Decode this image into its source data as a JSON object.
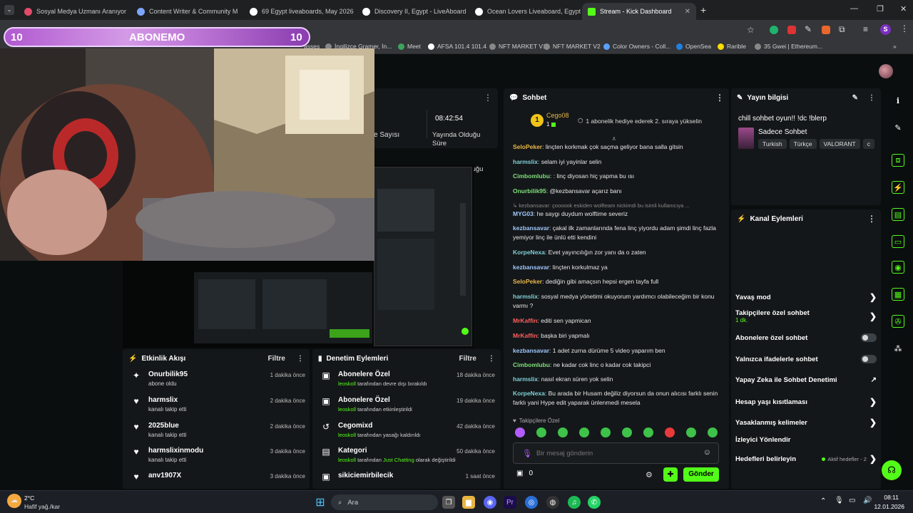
{
  "browser": {
    "tabs": [
      {
        "title": "Sosyal Medya Uzmanı Aranıyor",
        "color": "#e24a6b"
      },
      {
        "title": "Content Writer & Community M",
        "color": "#7da6ff"
      },
      {
        "title": "69 Egypt liveaboards, May 2026",
        "color": "#ffffff"
      },
      {
        "title": "Discovery II, Egypt - LiveAboard",
        "color": "#ffffff"
      },
      {
        "title": "Ocean Lovers Liveaboard, Egypt",
        "color": "#ffffff"
      },
      {
        "title": "Stream - Kick Dashboard",
        "color": "#53fc18"
      }
    ],
    "bookmarks": [
      {
        "label": "asses"
      },
      {
        "label": "İngilizce Gramer, İn..."
      },
      {
        "label": "Meet"
      },
      {
        "label": "AFSA 101.4 101.4"
      },
      {
        "label": "NFT MARKET V1"
      },
      {
        "label": "NFT MARKET V2"
      },
      {
        "label": "Color Owners - Coll..."
      },
      {
        "label": "OpenSea"
      },
      {
        "label": "Rarible"
      },
      {
        "label": "35 Gwei | Ethereum..."
      }
    ],
    "profile_letter": "S"
  },
  "overlay": {
    "left_count": "10",
    "title": "ABONEMO",
    "right_count": "10"
  },
  "stats": {
    "viewers_label": "e Sayısı",
    "uptime_value": "08:42:54",
    "uptime_label": "Yayında Olduğu Süre"
  },
  "activity": {
    "title": "Etkinlik Akışı",
    "filter": "Filtre",
    "items": [
      {
        "icon": "sparkle-icon",
        "glyph": "✦",
        "name": "Onurbilik95",
        "sub": "abone oldu",
        "time": "1 dakika önce"
      },
      {
        "icon": "heart-icon",
        "glyph": "♥",
        "name": "harmslix",
        "sub": "kanalı takip etti",
        "time": "2 dakika önce"
      },
      {
        "icon": "heart-icon",
        "glyph": "♥",
        "name": "2025blue",
        "sub": "kanalı takip etti",
        "time": "2 dakika önce"
      },
      {
        "icon": "heart-icon",
        "glyph": "♥",
        "name": "harmslixinmodu",
        "sub": "kanalı takip etti",
        "time": "3 dakika önce"
      },
      {
        "icon": "heart-icon",
        "glyph": "♥",
        "name": "anv1907X",
        "sub": "",
        "time": "3 dakika önce"
      }
    ]
  },
  "moderation": {
    "title": "Denetim Eylemleri",
    "filter": "Filtre",
    "items": [
      {
        "icon": "gift-icon",
        "glyph": "▣",
        "name": "Abonelere Özel",
        "user": "leoskoll",
        "sub": " tarafından devre dışı bırakıldı",
        "time": "18 dakika önce"
      },
      {
        "icon": "gift-icon",
        "glyph": "▣",
        "name": "Abonelere Özel",
        "user": "leoskoll",
        "sub": " tarafından etkinleştirildi",
        "time": "19 dakika önce"
      },
      {
        "icon": "undo-icon",
        "glyph": "↺",
        "name": "Cegomixd",
        "user": "leoskoll",
        "sub": " tarafından yasağı kaldırıldı",
        "time": "42 dakika önce"
      },
      {
        "icon": "category-icon",
        "glyph": "▤",
        "name": "Kategori",
        "user": "leoskoll",
        "sub": " tarafından ",
        "hl": "Just Chatting",
        "sub2": " olarak değiştirildi",
        "time": "50 dakika önce"
      },
      {
        "icon": "gift-icon",
        "glyph": "▣",
        "name": "sikiciemirbilecik",
        "user": "",
        "sub": "",
        "time": "1 saat önce"
      }
    ]
  },
  "chat": {
    "title": "Sohbet",
    "pinned_rank": "1",
    "pinned_user": "Cego08",
    "pinned_count": "1",
    "pinned_text": "1 abonelik hediye ederek 2. sıraya yükselin",
    "messages": [
      {
        "user": "SeloPeker",
        "color": "#e8b84a",
        "text": "linçten korkmak çok saçma geliyor bana salla gitsin"
      },
      {
        "user": "harmslix",
        "color": "#7fd0d8",
        "text": "selam iyi yayinlar selin"
      },
      {
        "user": "Cimbomlubu",
        "color": "#7fe07a",
        "text": ": linç diyosan hiç yapma bu ısı"
      },
      {
        "user": "Onurbilik95",
        "color": "#7fe07a",
        "text": "@kezbansavar açarız banı"
      },
      {
        "user": "",
        "color": "#888888",
        "text": "↳ kezbansavar: çoooook eskiden wolfteam nickimdi bu isimli kullanıcıya ..."
      },
      {
        "user": "MYG03",
        "color": "#a0c8ff",
        "text": "he saygı duydum wolftime severiz"
      },
      {
        "user": "kezbansavar",
        "color": "#a0c8ff",
        "text": "çakal ilk zamanlarında fena linç yiyordu adam şimdi linç fazla yemiyor linç ile ünlü etti kendini"
      },
      {
        "user": "KorpeNexa",
        "color": "#7fd0d8",
        "text": "Evet yayıncılığın zor yanı da o zaten"
      },
      {
        "user": "kezbansavar",
        "color": "#a0c8ff",
        "text": "linçten korkulmaz ya"
      },
      {
        "user": "SeloPeker",
        "color": "#e8b84a",
        "text": "dediğin gibi amaçsın hepsi ergen tayfa full"
      },
      {
        "user": "harmslix",
        "color": "#7fd0d8",
        "text": "sosyal medya yönetimi okuyorum yardımcı olabileceğim bir konu varmı ?"
      },
      {
        "user": "MrKaffin",
        "color": "#ff5e5e",
        "text": "editi sen yapmican"
      },
      {
        "user": "MrKaffin",
        "color": "#ff5e5e",
        "text": "başka biri yapmalı"
      },
      {
        "user": "kezbansavar",
        "color": "#a0c8ff",
        "text": "1 adet zurna dürüme 5 video yaparım ben"
      },
      {
        "user": "Cimbomlubu",
        "color": "#7fe07a",
        "text": "ne kadar cok linc o kadar cok takipci"
      },
      {
        "user": "harmslix",
        "color": "#7fd0d8",
        "text": "nasıl ekran süren yok selin"
      },
      {
        "user": "KorpeNexa",
        "color": "#7fd0d8",
        "text": "Bu arada bir Husam değiliz diyorsun da onun alıcısı farklı senin farklı yani Hype edit yaparak ünlenmedi mesela"
      }
    ],
    "followers_only": "Takipçilere Özel",
    "input_placeholder": "Bir mesaj gönderin",
    "points": "0",
    "send_label": "Gönder"
  },
  "stream_info": {
    "title": "Yayın bilgisi",
    "stream_title": "chill sohbet oyun!! !dc !blerp",
    "category": "Sadece Sohbet",
    "tags": [
      "Turkish",
      "Türkçe",
      "VALORANT",
      "c"
    ]
  },
  "channel_actions": {
    "title": "Kanal Eylemleri",
    "items": [
      {
        "label": "Yavaş mod",
        "kind": "chevron",
        "sub": ""
      },
      {
        "label": "Takipçilere özel sohbet",
        "kind": "chevron",
        "sub": "1 dk."
      },
      {
        "label": "Abonelere özel sohbet",
        "kind": "toggle",
        "sub": ""
      },
      {
        "label": "Yalnızca ifadelerle sohbet",
        "kind": "toggle",
        "sub": ""
      },
      {
        "label": "Yapay Zeka ile Sohbet Denetimi",
        "kind": "external",
        "sub": ""
      },
      {
        "label": "Hesap yaşı kısıtlaması",
        "kind": "chevron",
        "sub": ""
      },
      {
        "label": "Yasaklanmış kelimeler",
        "kind": "chevron",
        "sub": ""
      },
      {
        "label": "İzleyici Yönlendir",
        "kind": "none",
        "sub": ""
      },
      {
        "label": "Hedefleri belirleyin",
        "kind": "goals",
        "sub": "Aktif hedefler - 2"
      }
    ]
  },
  "taskbar": {
    "weather_temp": "2°C",
    "weather_desc": "Hafif yağ./kar",
    "search_placeholder": "Ara",
    "time": "08:11",
    "date": "12.01.2026"
  },
  "colors": {
    "accent": "#53fc18",
    "panel": "#141719",
    "page": "#0b0e0f"
  }
}
